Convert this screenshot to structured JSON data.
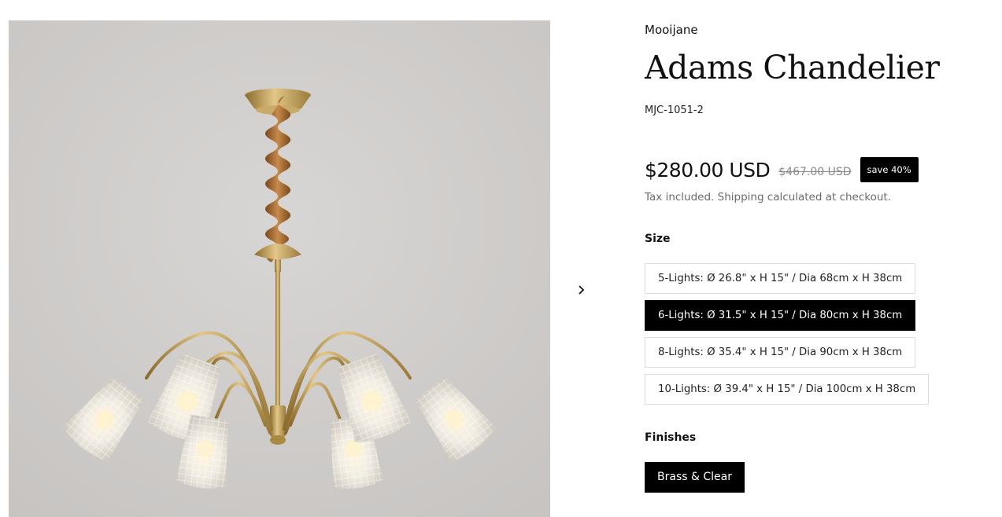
{
  "product": {
    "vendor": "Mooijane",
    "title": "Adams Chandelier",
    "sku": "MJC-1051-2",
    "image_alt": "Brass chandelier with textured glass shades"
  },
  "pricing": {
    "price": "$280.00 USD",
    "compare_price": "$467.00 USD",
    "badge": "save 40%",
    "tax_note": "Tax included. Shipping calculated at checkout."
  },
  "options": {
    "size_label": "Size",
    "sizes": [
      {
        "label": "5-Lights: Ø 26.8\" x H 15\" / Dia 68cm x H 38cm",
        "selected": false
      },
      {
        "label": "6-Lights: Ø 31.5\" x H 15\" / Dia 80cm x H 38cm",
        "selected": true
      },
      {
        "label": "8-Lights: Ø 35.4\" x H 15\" / Dia 90cm x H 38cm",
        "selected": false
      },
      {
        "label": "10-Lights: Ø 39.4\" x H 15\" / Dia 100cm x H 38cm",
        "selected": false
      }
    ],
    "finish_label": "Finishes",
    "finishes": [
      {
        "label": "Brass & Clear",
        "selected": true
      }
    ]
  },
  "gallery": {
    "next_icon": "chevron-right-icon"
  },
  "colors": {
    "accent": "#000000",
    "muted_text": "#6b6b6b",
    "border": "#dedede",
    "image_bg": "#cfcccb",
    "brass": "#b8974f"
  }
}
